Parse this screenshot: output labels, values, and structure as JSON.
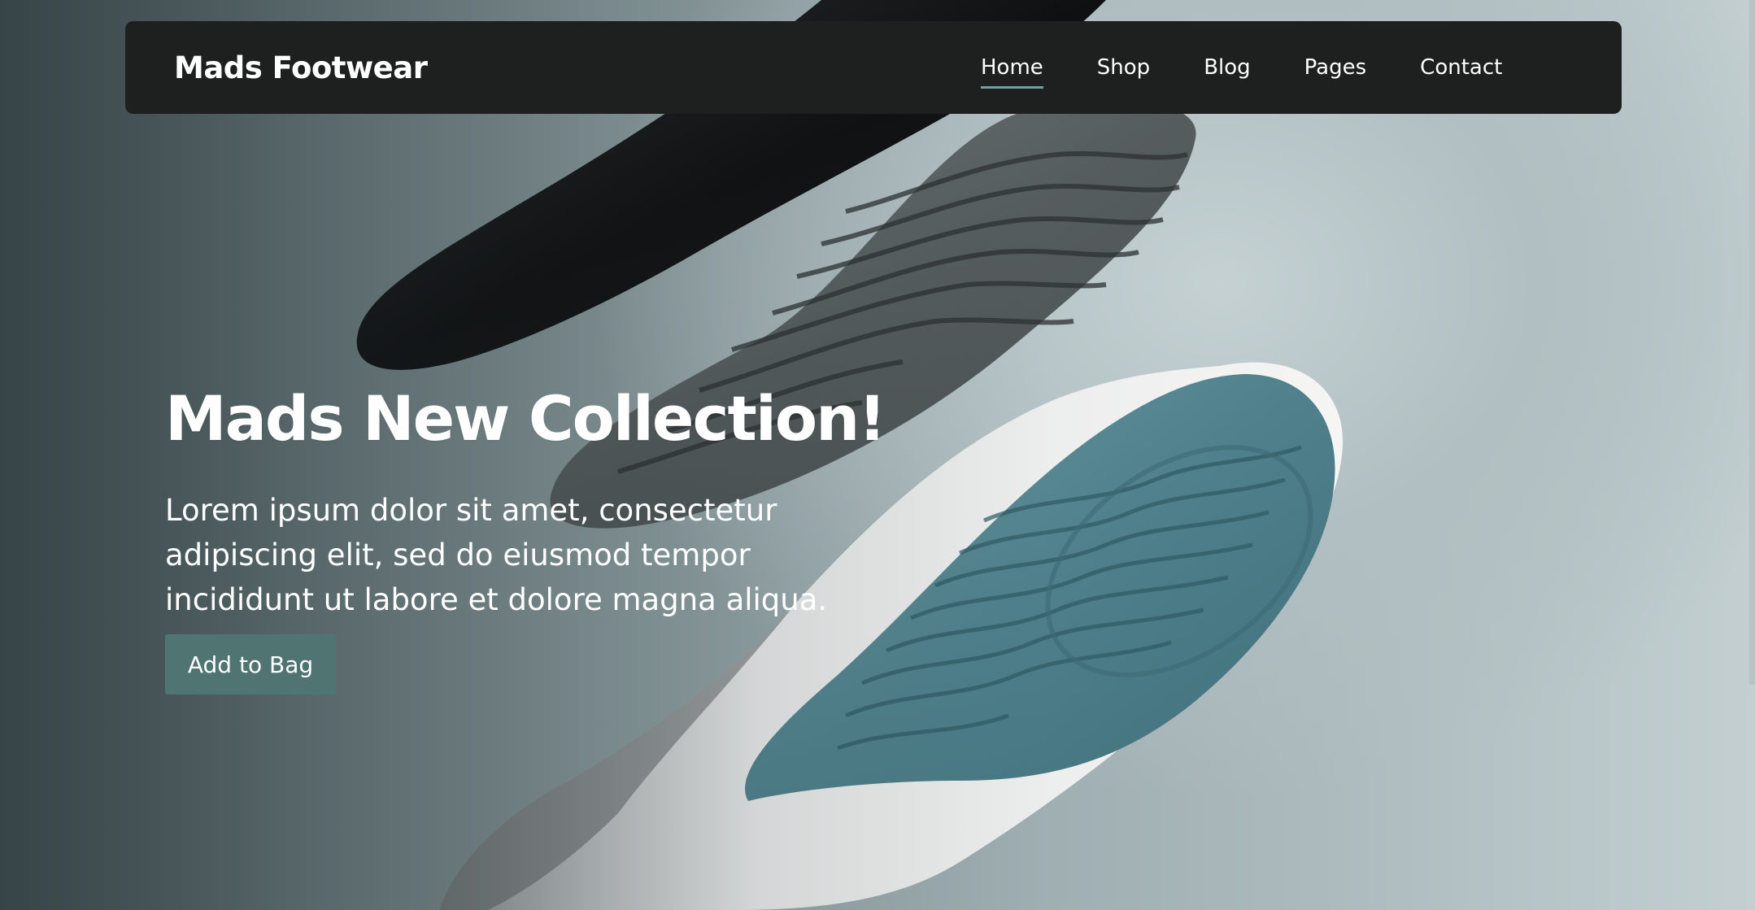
{
  "brand": "Mads Footwear",
  "nav": {
    "items": [
      "Home",
      "Shop",
      "Blog",
      "Pages",
      "Contact"
    ],
    "active": "Home",
    "accent_color": "#6aa3a1"
  },
  "hero": {
    "title": "Mads New Collection!",
    "description": "Lorem ipsum dolor sit amet, consectetur adipiscing elit, sed do eiusmod tempor incididunt ut labore et dolore magna aliqua.",
    "cta_label": "Add to Bag",
    "cta_color": "#4f7471",
    "image": "shoe-soles-photo"
  },
  "colors": {
    "navbar_bg": "#1e1f1f",
    "text": "#ffffff"
  }
}
